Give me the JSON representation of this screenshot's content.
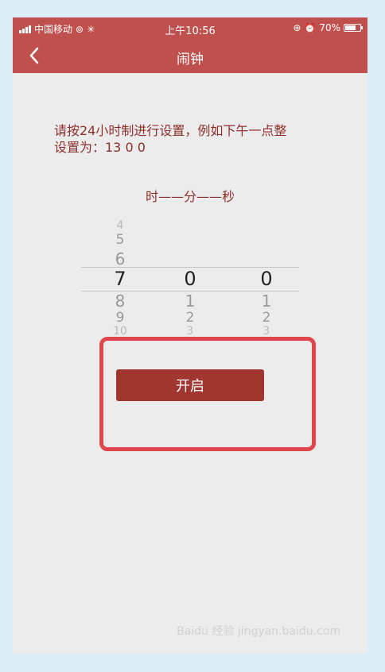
{
  "statusbar": {
    "carrier": "中国移动",
    "time": "上午10:56",
    "battery": "70%",
    "battery_fraction": 0.7
  },
  "navbar": {
    "title": "闹钟"
  },
  "instruction": {
    "line1": "请按24小时制进行设置，例如下午一点整",
    "line2": "设置为：13 0 0"
  },
  "columns_label": "时——分——秒",
  "picker": {
    "hours": {
      "above": [
        "4",
        "5",
        "6"
      ],
      "selected": "7",
      "below": [
        "8",
        "9",
        "10"
      ]
    },
    "minutes": {
      "selected": "0",
      "below": [
        "1",
        "2",
        "3"
      ]
    },
    "seconds": {
      "selected": "0",
      "below": [
        "1",
        "2",
        "3"
      ]
    }
  },
  "start_button": {
    "label": "开启"
  },
  "watermark": "Baidu 经验 jingyan.baidu.com",
  "colors": {
    "header": "#c0504d",
    "button": "#a13530",
    "text": "#8d2f2b",
    "highlight": "#e0474c"
  }
}
